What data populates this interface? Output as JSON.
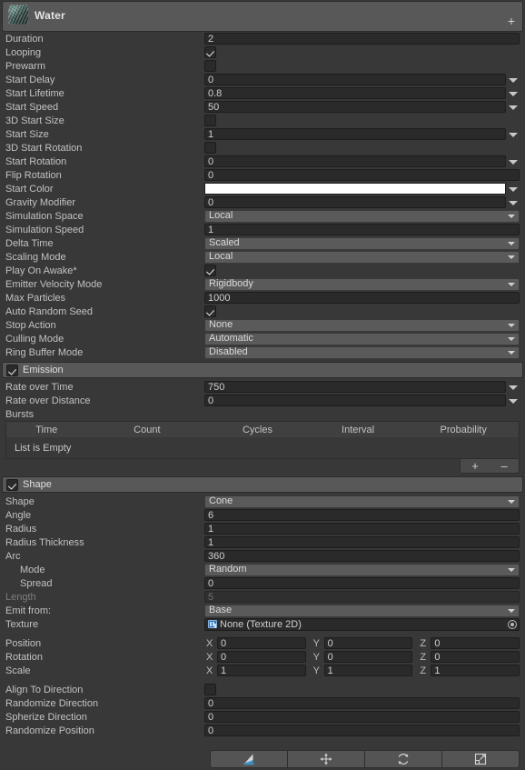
{
  "header": {
    "title": "Water",
    "icon": "material-sphere-preview-icon",
    "add_label": "+"
  },
  "main_module": {
    "rows": [
      {
        "label": "Duration",
        "type": "text",
        "value": "2"
      },
      {
        "label": "Looping",
        "type": "check",
        "value": true
      },
      {
        "label": "Prewarm",
        "type": "check",
        "value": false
      },
      {
        "label": "Start Delay",
        "type": "minmax",
        "value": "0"
      },
      {
        "label": "Start Lifetime",
        "type": "minmax",
        "value": "0.8"
      },
      {
        "label": "Start Speed",
        "type": "minmax",
        "value": "50"
      },
      {
        "label": "3D Start Size",
        "type": "check",
        "value": false
      },
      {
        "label": "Start Size",
        "type": "minmax",
        "value": "1"
      },
      {
        "label": "3D Start Rotation",
        "type": "check",
        "value": false
      },
      {
        "label": "Start Rotation",
        "type": "minmax",
        "value": "0"
      },
      {
        "label": "Flip Rotation",
        "type": "text",
        "value": "0"
      },
      {
        "label": "Start Color",
        "type": "color",
        "value": "#ffffff"
      },
      {
        "label": "Gravity Modifier",
        "type": "minmax",
        "value": "0"
      },
      {
        "label": "Simulation Space",
        "type": "popup",
        "value": "Local"
      },
      {
        "label": "Simulation Speed",
        "type": "text",
        "value": "1"
      },
      {
        "label": "Delta Time",
        "type": "popup",
        "value": "Scaled"
      },
      {
        "label": "Scaling Mode",
        "type": "popup",
        "value": "Local"
      },
      {
        "label": "Play On Awake*",
        "type": "check",
        "value": true
      },
      {
        "label": "Emitter Velocity Mode",
        "type": "popup",
        "value": "Rigidbody"
      },
      {
        "label": "Max Particles",
        "type": "text",
        "value": "1000"
      },
      {
        "label": "Auto Random Seed",
        "type": "check",
        "value": true
      },
      {
        "label": "Stop Action",
        "type": "popup",
        "value": "None"
      },
      {
        "label": "Culling Mode",
        "type": "popup",
        "value": "Automatic"
      },
      {
        "label": "Ring Buffer Mode",
        "type": "popup",
        "value": "Disabled"
      }
    ]
  },
  "emission": {
    "title": "Emission",
    "enabled": true,
    "rows": [
      {
        "label": "Rate over Time",
        "type": "minmax",
        "value": "750"
      },
      {
        "label": "Rate over Distance",
        "type": "minmax",
        "value": "0"
      }
    ],
    "bursts_label": "Bursts",
    "bursts_columns": [
      "Time",
      "Count",
      "Cycles",
      "Interval",
      "Probability"
    ],
    "bursts_rows": [],
    "empty_text": "List is Empty",
    "add_label": "+",
    "remove_label": "–"
  },
  "shape": {
    "title": "Shape",
    "enabled": true,
    "rows": [
      {
        "label": "Shape",
        "type": "popup",
        "value": "Cone",
        "indent": false,
        "disabled": false
      },
      {
        "label": "Angle",
        "type": "text",
        "value": "6",
        "indent": false,
        "disabled": false
      },
      {
        "label": "Radius",
        "type": "text",
        "value": "1",
        "indent": false,
        "disabled": false
      },
      {
        "label": "Radius Thickness",
        "type": "text",
        "value": "1",
        "indent": false,
        "disabled": false
      },
      {
        "label": "Arc",
        "type": "text",
        "value": "360",
        "indent": false,
        "disabled": false
      },
      {
        "label": "Mode",
        "type": "popup",
        "value": "Random",
        "indent": true,
        "disabled": false
      },
      {
        "label": "Spread",
        "type": "text",
        "value": "0",
        "indent": true,
        "disabled": false
      },
      {
        "label": "Length",
        "type": "text",
        "value": "5",
        "indent": false,
        "disabled": true
      },
      {
        "label": "Emit from:",
        "type": "popup",
        "value": "Base",
        "indent": false,
        "disabled": false
      }
    ],
    "texture": {
      "label": "Texture",
      "value": "None (Texture 2D)",
      "icon": "texture2d-icon",
      "picker_icon": "object-picker-icon"
    },
    "transform": [
      {
        "label": "Position",
        "x": "0",
        "y": "0",
        "z": "0"
      },
      {
        "label": "Rotation",
        "x": "0",
        "y": "0",
        "z": "0"
      },
      {
        "label": "Scale",
        "x": "1",
        "y": "1",
        "z": "1"
      }
    ],
    "axis_labels": {
      "x": "X",
      "y": "Y",
      "z": "Z"
    },
    "tail_rows": [
      {
        "label": "Align To Direction",
        "type": "check",
        "value": false
      },
      {
        "label": "Randomize Direction",
        "type": "text",
        "value": "0"
      },
      {
        "label": "Spherize Direction",
        "type": "text",
        "value": "0"
      },
      {
        "label": "Randomize Position",
        "type": "text",
        "value": "0"
      }
    ]
  },
  "toolbar": {
    "buttons": [
      {
        "name": "shape-gizmo-tool",
        "icon": "cone-gizmo-icon"
      },
      {
        "name": "move-tool",
        "icon": "move-arrows-icon"
      },
      {
        "name": "rotate-tool",
        "icon": "rotate-arrows-icon"
      },
      {
        "name": "scale-tool",
        "icon": "scale-expand-icon"
      }
    ]
  }
}
